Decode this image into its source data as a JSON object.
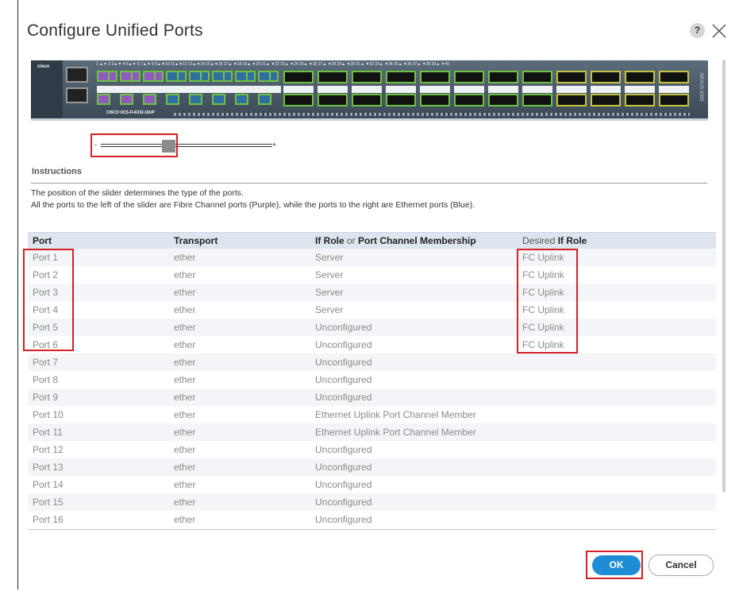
{
  "dialog": {
    "title": "Configure Unified Ports",
    "help_label": "?"
  },
  "switch_image": {
    "brand": "cisco",
    "model": "CISCO UCS-FI-6332-16UP",
    "rotated_label": "NEXUS 6332",
    "port_labels": "1 ▲▼ 2  3▲▼ 4  5▲▼ 6  7▲▼ 8  9▲▼10  11▲▼12  13▲▼14  15▲▼16   17▲ ▼18   19▲ ▼20   21▲ ▼22   23▲ ▼24   25▲ ▼26   27▲ ▼28   29▲ ▼30   31▲ ▼32   33▲ ▼34   35▲ ▼36   37▲ ▼38   39▲ ▼40",
    "colors": {
      "fc": "#8f5ac0",
      "ethernet": "#2e6ea0",
      "link": "#6fc23f"
    }
  },
  "slider": {
    "minus_label": "-",
    "plus_label": "+",
    "fc_port_count": 6,
    "total_unified_ports": 16
  },
  "instructions": {
    "heading": "Instructions",
    "line1": "The position of the slider determines the type of the ports.",
    "line2": "All the ports to the left of the slider are Fibre Channel ports (Purple), while the ports to the right are Ethernet ports (Blue)."
  },
  "table": {
    "columns": {
      "port": "Port",
      "transport": "Transport",
      "if_role_a": "If Role",
      "if_role_or": " or ",
      "if_role_b": "Port Channel Membership",
      "desired_a": "Desired ",
      "desired_b": "If Role"
    },
    "rows": [
      {
        "port": "Port 1",
        "transport": "ether",
        "role": "Server",
        "desired": "FC Uplink"
      },
      {
        "port": "Port 2",
        "transport": "ether",
        "role": "Server",
        "desired": "FC Uplink"
      },
      {
        "port": "Port 3",
        "transport": "ether",
        "role": "Server",
        "desired": "FC Uplink"
      },
      {
        "port": "Port 4",
        "transport": "ether",
        "role": "Server",
        "desired": "FC Uplink"
      },
      {
        "port": "Port 5",
        "transport": "ether",
        "role": "Unconfigured",
        "desired": "FC Uplink"
      },
      {
        "port": "Port 6",
        "transport": "ether",
        "role": "Unconfigured",
        "desired": "FC Uplink"
      },
      {
        "port": "Port 7",
        "transport": "ether",
        "role": "Unconfigured",
        "desired": ""
      },
      {
        "port": "Port 8",
        "transport": "ether",
        "role": "Unconfigured",
        "desired": ""
      },
      {
        "port": "Port 9",
        "transport": "ether",
        "role": "Unconfigured",
        "desired": ""
      },
      {
        "port": "Port 10",
        "transport": "ether",
        "role": "Ethernet Uplink Port Channel Member",
        "desired": ""
      },
      {
        "port": "Port 11",
        "transport": "ether",
        "role": "Ethernet Uplink Port Channel Member",
        "desired": ""
      },
      {
        "port": "Port 12",
        "transport": "ether",
        "role": "Unconfigured",
        "desired": ""
      },
      {
        "port": "Port 13",
        "transport": "ether",
        "role": "Unconfigured",
        "desired": ""
      },
      {
        "port": "Port 14",
        "transport": "ether",
        "role": "Unconfigured",
        "desired": ""
      },
      {
        "port": "Port 15",
        "transport": "ether",
        "role": "Unconfigured",
        "desired": ""
      },
      {
        "port": "Port 16",
        "transport": "ether",
        "role": "Unconfigured",
        "desired": ""
      }
    ]
  },
  "buttons": {
    "ok": "OK",
    "cancel": "Cancel"
  },
  "colors": {
    "accent": "#1f8dd6",
    "highlight": "#d61f26",
    "header_bg": "#dde6ee"
  }
}
